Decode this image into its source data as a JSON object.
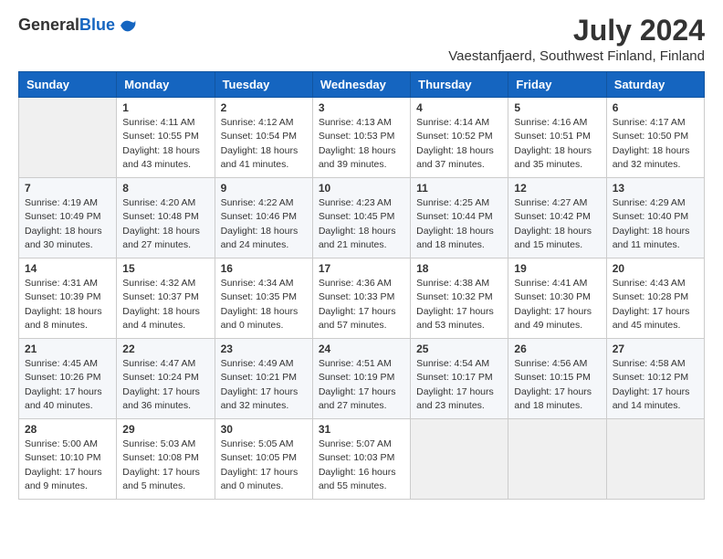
{
  "header": {
    "logo_general": "General",
    "logo_blue": "Blue",
    "month_title": "July 2024",
    "location": "Vaestanfjaerd, Southwest Finland, Finland"
  },
  "weekdays": [
    "Sunday",
    "Monday",
    "Tuesday",
    "Wednesday",
    "Thursday",
    "Friday",
    "Saturday"
  ],
  "weeks": [
    [
      {
        "day": "",
        "empty": true
      },
      {
        "day": "1",
        "sunrise": "Sunrise: 4:11 AM",
        "sunset": "Sunset: 10:55 PM",
        "daylight": "Daylight: 18 hours and 43 minutes."
      },
      {
        "day": "2",
        "sunrise": "Sunrise: 4:12 AM",
        "sunset": "Sunset: 10:54 PM",
        "daylight": "Daylight: 18 hours and 41 minutes."
      },
      {
        "day": "3",
        "sunrise": "Sunrise: 4:13 AM",
        "sunset": "Sunset: 10:53 PM",
        "daylight": "Daylight: 18 hours and 39 minutes."
      },
      {
        "day": "4",
        "sunrise": "Sunrise: 4:14 AM",
        "sunset": "Sunset: 10:52 PM",
        "daylight": "Daylight: 18 hours and 37 minutes."
      },
      {
        "day": "5",
        "sunrise": "Sunrise: 4:16 AM",
        "sunset": "Sunset: 10:51 PM",
        "daylight": "Daylight: 18 hours and 35 minutes."
      },
      {
        "day": "6",
        "sunrise": "Sunrise: 4:17 AM",
        "sunset": "Sunset: 10:50 PM",
        "daylight": "Daylight: 18 hours and 32 minutes."
      }
    ],
    [
      {
        "day": "7",
        "sunrise": "Sunrise: 4:19 AM",
        "sunset": "Sunset: 10:49 PM",
        "daylight": "Daylight: 18 hours and 30 minutes."
      },
      {
        "day": "8",
        "sunrise": "Sunrise: 4:20 AM",
        "sunset": "Sunset: 10:48 PM",
        "daylight": "Daylight: 18 hours and 27 minutes."
      },
      {
        "day": "9",
        "sunrise": "Sunrise: 4:22 AM",
        "sunset": "Sunset: 10:46 PM",
        "daylight": "Daylight: 18 hours and 24 minutes."
      },
      {
        "day": "10",
        "sunrise": "Sunrise: 4:23 AM",
        "sunset": "Sunset: 10:45 PM",
        "daylight": "Daylight: 18 hours and 21 minutes."
      },
      {
        "day": "11",
        "sunrise": "Sunrise: 4:25 AM",
        "sunset": "Sunset: 10:44 PM",
        "daylight": "Daylight: 18 hours and 18 minutes."
      },
      {
        "day": "12",
        "sunrise": "Sunrise: 4:27 AM",
        "sunset": "Sunset: 10:42 PM",
        "daylight": "Daylight: 18 hours and 15 minutes."
      },
      {
        "day": "13",
        "sunrise": "Sunrise: 4:29 AM",
        "sunset": "Sunset: 10:40 PM",
        "daylight": "Daylight: 18 hours and 11 minutes."
      }
    ],
    [
      {
        "day": "14",
        "sunrise": "Sunrise: 4:31 AM",
        "sunset": "Sunset: 10:39 PM",
        "daylight": "Daylight: 18 hours and 8 minutes."
      },
      {
        "day": "15",
        "sunrise": "Sunrise: 4:32 AM",
        "sunset": "Sunset: 10:37 PM",
        "daylight": "Daylight: 18 hours and 4 minutes."
      },
      {
        "day": "16",
        "sunrise": "Sunrise: 4:34 AM",
        "sunset": "Sunset: 10:35 PM",
        "daylight": "Daylight: 18 hours and 0 minutes."
      },
      {
        "day": "17",
        "sunrise": "Sunrise: 4:36 AM",
        "sunset": "Sunset: 10:33 PM",
        "daylight": "Daylight: 17 hours and 57 minutes."
      },
      {
        "day": "18",
        "sunrise": "Sunrise: 4:38 AM",
        "sunset": "Sunset: 10:32 PM",
        "daylight": "Daylight: 17 hours and 53 minutes."
      },
      {
        "day": "19",
        "sunrise": "Sunrise: 4:41 AM",
        "sunset": "Sunset: 10:30 PM",
        "daylight": "Daylight: 17 hours and 49 minutes."
      },
      {
        "day": "20",
        "sunrise": "Sunrise: 4:43 AM",
        "sunset": "Sunset: 10:28 PM",
        "daylight": "Daylight: 17 hours and 45 minutes."
      }
    ],
    [
      {
        "day": "21",
        "sunrise": "Sunrise: 4:45 AM",
        "sunset": "Sunset: 10:26 PM",
        "daylight": "Daylight: 17 hours and 40 minutes."
      },
      {
        "day": "22",
        "sunrise": "Sunrise: 4:47 AM",
        "sunset": "Sunset: 10:24 PM",
        "daylight": "Daylight: 17 hours and 36 minutes."
      },
      {
        "day": "23",
        "sunrise": "Sunrise: 4:49 AM",
        "sunset": "Sunset: 10:21 PM",
        "daylight": "Daylight: 17 hours and 32 minutes."
      },
      {
        "day": "24",
        "sunrise": "Sunrise: 4:51 AM",
        "sunset": "Sunset: 10:19 PM",
        "daylight": "Daylight: 17 hours and 27 minutes."
      },
      {
        "day": "25",
        "sunrise": "Sunrise: 4:54 AM",
        "sunset": "Sunset: 10:17 PM",
        "daylight": "Daylight: 17 hours and 23 minutes."
      },
      {
        "day": "26",
        "sunrise": "Sunrise: 4:56 AM",
        "sunset": "Sunset: 10:15 PM",
        "daylight": "Daylight: 17 hours and 18 minutes."
      },
      {
        "day": "27",
        "sunrise": "Sunrise: 4:58 AM",
        "sunset": "Sunset: 10:12 PM",
        "daylight": "Daylight: 17 hours and 14 minutes."
      }
    ],
    [
      {
        "day": "28",
        "sunrise": "Sunrise: 5:00 AM",
        "sunset": "Sunset: 10:10 PM",
        "daylight": "Daylight: 17 hours and 9 minutes."
      },
      {
        "day": "29",
        "sunrise": "Sunrise: 5:03 AM",
        "sunset": "Sunset: 10:08 PM",
        "daylight": "Daylight: 17 hours and 5 minutes."
      },
      {
        "day": "30",
        "sunrise": "Sunrise: 5:05 AM",
        "sunset": "Sunset: 10:05 PM",
        "daylight": "Daylight: 17 hours and 0 minutes."
      },
      {
        "day": "31",
        "sunrise": "Sunrise: 5:07 AM",
        "sunset": "Sunset: 10:03 PM",
        "daylight": "Daylight: 16 hours and 55 minutes."
      },
      {
        "day": "",
        "empty": true
      },
      {
        "day": "",
        "empty": true
      },
      {
        "day": "",
        "empty": true
      }
    ]
  ]
}
